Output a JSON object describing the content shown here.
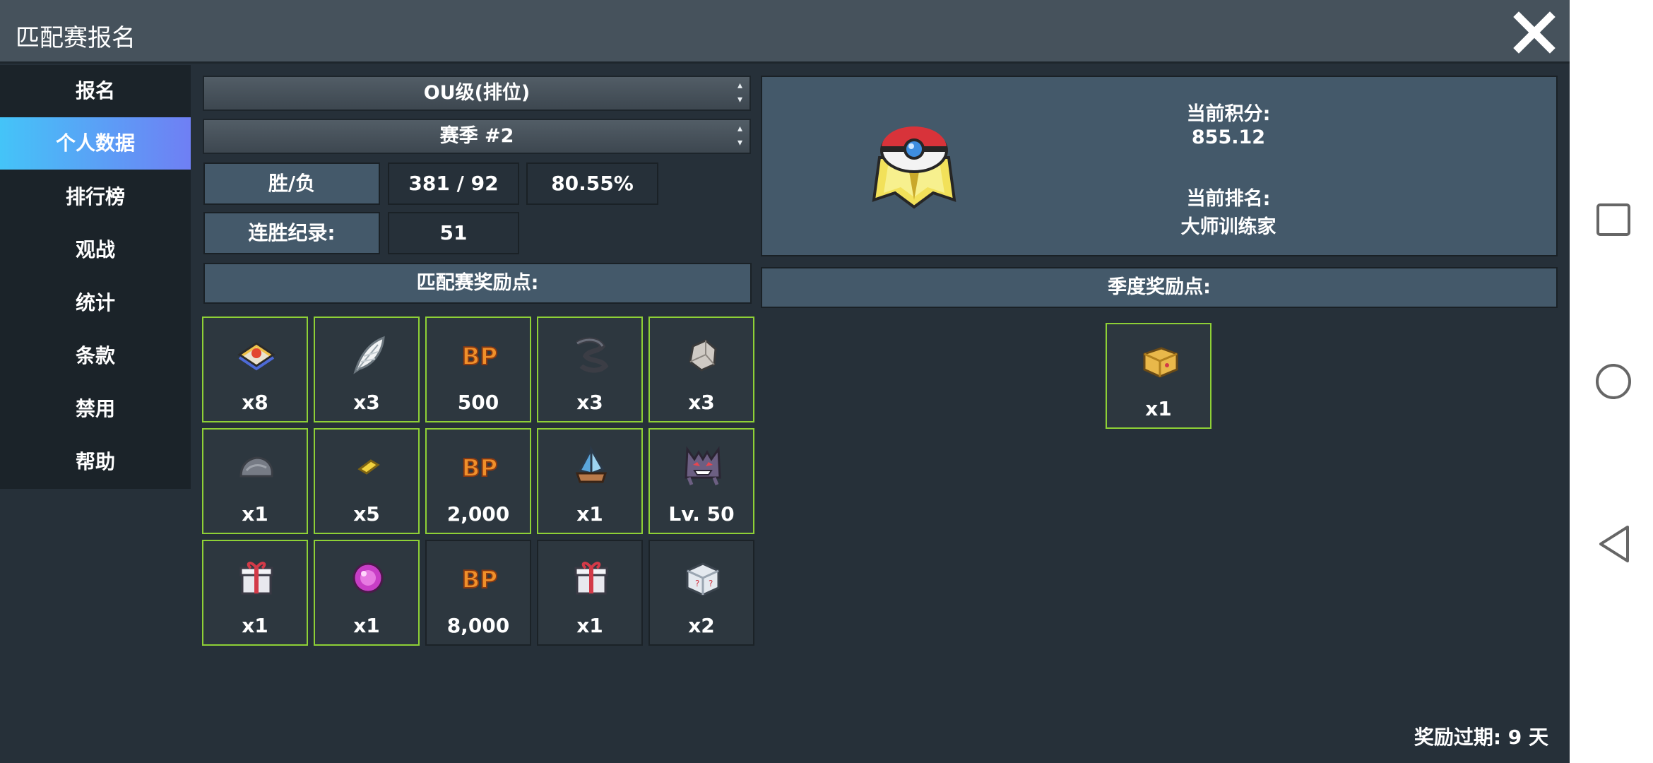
{
  "window": {
    "title": "匹配赛报名"
  },
  "sidebar": {
    "items": [
      {
        "label": "报名"
      },
      {
        "label": "个人数据"
      },
      {
        "label": "排行榜"
      },
      {
        "label": "观战"
      },
      {
        "label": "统计"
      },
      {
        "label": "条款"
      },
      {
        "label": "禁用"
      },
      {
        "label": "帮助"
      }
    ],
    "active_index": 1
  },
  "selects": {
    "tier": "OU级(排位)",
    "season": "赛季 #2"
  },
  "stats": {
    "win_loss_label": "胜/负",
    "win_loss_value": "381 / 92",
    "win_rate": "80.55%",
    "streak_label": "连胜纪录:",
    "streak_value": "51"
  },
  "rank": {
    "points_label": "当前积分:",
    "points_value": "855.12",
    "rank_label": "当前排名:",
    "rank_value": "大师训练家"
  },
  "match_rewards": {
    "header": "匹配赛奖励点:",
    "items": [
      {
        "icon": "ticket-icon",
        "qty": "x8",
        "claimed": true
      },
      {
        "icon": "feather-icon",
        "qty": "x3",
        "claimed": true
      },
      {
        "icon": "bp-icon",
        "qty": "500",
        "claimed": true
      },
      {
        "icon": "scarf-icon",
        "qty": "x3",
        "claimed": true
      },
      {
        "icon": "stone-icon",
        "qty": "x3",
        "claimed": true
      },
      {
        "icon": "rock-icon",
        "qty": "x1",
        "claimed": true
      },
      {
        "icon": "gold-bar-icon",
        "qty": "x5",
        "claimed": true
      },
      {
        "icon": "bp-icon",
        "qty": "2,000",
        "claimed": true
      },
      {
        "icon": "crystal-icon",
        "qty": "x1",
        "claimed": true
      },
      {
        "icon": "gengar-icon",
        "qty": "Lv. 50",
        "claimed": true
      },
      {
        "icon": "gift-box-icon",
        "qty": "x1",
        "claimed": true
      },
      {
        "icon": "orb-icon",
        "qty": "x1",
        "claimed": true
      },
      {
        "icon": "bp-icon",
        "qty": "8,000",
        "claimed": false
      },
      {
        "icon": "gift-box-icon",
        "qty": "x1",
        "claimed": false
      },
      {
        "icon": "mystery-box-icon",
        "qty": "x2",
        "claimed": false
      }
    ]
  },
  "season_rewards": {
    "header": "季度奖励点:",
    "items": [
      {
        "icon": "gold-box-icon",
        "qty": "x1",
        "claimed": true
      }
    ]
  },
  "footer": {
    "expire": "奖励过期: 9 天"
  },
  "colors": {
    "background": "#263039",
    "sidebar_active_start": "#44c4f8",
    "sidebar_active_end": "#6f7ff4",
    "highlight_border": "#8ed036",
    "panel": "#44596a"
  }
}
